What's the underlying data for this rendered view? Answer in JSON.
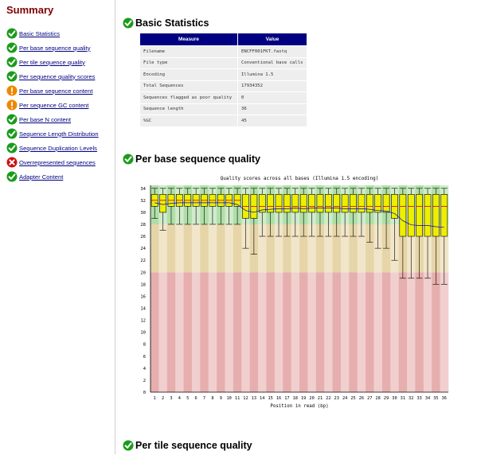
{
  "summary": {
    "title": "Summary",
    "items": [
      {
        "label": "Basic Statistics",
        "status": "pass"
      },
      {
        "label": "Per base sequence quality",
        "status": "pass"
      },
      {
        "label": "Per tile sequence quality",
        "status": "pass"
      },
      {
        "label": "Per sequence quality scores",
        "status": "pass"
      },
      {
        "label": "Per base sequence content",
        "status": "warn"
      },
      {
        "label": "Per sequence GC content",
        "status": "warn"
      },
      {
        "label": "Per base N content",
        "status": "pass"
      },
      {
        "label": "Sequence Length Distribution",
        "status": "pass"
      },
      {
        "label": "Sequence Duplication Levels",
        "status": "pass"
      },
      {
        "label": "Overrepresented sequences",
        "status": "fail"
      },
      {
        "label": "Adapter Content",
        "status": "pass"
      }
    ]
  },
  "basic_stats": {
    "title": "Basic Statistics",
    "status": "pass",
    "headers": [
      "Measure",
      "Value"
    ],
    "rows": [
      [
        "Filename",
        "ENCFF001FKT.fastq"
      ],
      [
        "File type",
        "Conventional base calls"
      ],
      [
        "Encoding",
        "Illumina 1.5"
      ],
      [
        "Total Sequences",
        "17934352"
      ],
      [
        "Sequences flagged as poor quality",
        "0"
      ],
      [
        "Sequence length",
        "36"
      ],
      [
        "%GC",
        "45"
      ]
    ]
  },
  "per_base_quality": {
    "title": "Per base sequence quality",
    "status": "pass"
  },
  "per_tile_quality": {
    "title": "Per tile sequence quality",
    "status": "pass"
  },
  "colors": {
    "pass": "#1a9c1a",
    "warn": "#ee8800",
    "fail": "#cc1111",
    "link": "#000080",
    "summary_title": "#800000",
    "table_header": "#000080",
    "box_fill": "#eeee00",
    "median": "#cc0000",
    "mean_line": "#0000cc"
  },
  "chart_data": {
    "type": "box",
    "title": "Quality scores across all bases (Illumina 1.5 encoding)",
    "xlabel": "Position in read (bp)",
    "ylabel": "",
    "ylim": [
      0,
      34
    ],
    "yticks": [
      0,
      2,
      4,
      6,
      8,
      10,
      12,
      14,
      16,
      18,
      20,
      22,
      24,
      26,
      28,
      30,
      32,
      34
    ],
    "categories": [
      "1",
      "2",
      "3",
      "4",
      "5",
      "6",
      "7",
      "8",
      "9",
      "10",
      "11",
      "12",
      "13",
      "14",
      "15",
      "16",
      "17",
      "18",
      "19",
      "20",
      "21",
      "22",
      "23",
      "24",
      "25",
      "26",
      "27",
      "28",
      "29",
      "30",
      "31",
      "32",
      "33",
      "34",
      "35",
      "36"
    ],
    "zones": [
      {
        "from": 0,
        "to": 20,
        "color": "#e6aeae",
        "color_alt": "#f1cfcf"
      },
      {
        "from": 20,
        "to": 28,
        "color": "#e6d5a8",
        "color_alt": "#f1e6ca"
      },
      {
        "from": 28,
        "to": 34.5,
        "color": "#b0dea8",
        "color_alt": "#d0ebca"
      }
    ],
    "series": {
      "upper_whisker": [
        34,
        34,
        34,
        34,
        34,
        34,
        34,
        34,
        34,
        34,
        34,
        34,
        34,
        34,
        34,
        34,
        34,
        34,
        34,
        34,
        34,
        34,
        34,
        34,
        34,
        34,
        34,
        34,
        34,
        34,
        34,
        34,
        34,
        34,
        34,
        34
      ],
      "q3": [
        33,
        33,
        33,
        33,
        33,
        33,
        33,
        33,
        33,
        33,
        33,
        33,
        33,
        33,
        33,
        33,
        33,
        33,
        33,
        33,
        33,
        33,
        33,
        33,
        33,
        33,
        33,
        33,
        33,
        33,
        33,
        33,
        33,
        33,
        33,
        33
      ],
      "median": [
        32,
        32,
        32,
        32,
        32,
        32,
        32,
        32,
        32,
        32,
        32,
        31,
        31,
        31,
        31,
        31,
        31,
        31,
        31,
        31,
        31,
        31,
        31,
        31,
        31,
        31,
        31,
        31,
        31,
        31,
        31,
        31,
        31,
        31,
        31,
        31
      ],
      "q1": [
        31,
        30,
        31,
        31,
        31,
        31,
        31,
        31,
        31,
        31,
        31,
        29,
        29,
        30,
        30,
        30,
        30,
        30,
        30,
        30,
        30,
        30,
        30,
        30,
        30,
        30,
        30,
        30,
        30,
        29,
        26,
        26,
        26,
        26,
        26,
        26
      ],
      "lower_whisker": [
        29,
        27,
        28,
        28,
        28,
        28,
        28,
        28,
        28,
        28,
        28,
        24,
        23,
        26,
        26,
        26,
        26,
        26,
        26,
        26,
        26,
        26,
        26,
        26,
        26,
        26,
        25,
        24,
        24,
        22,
        19,
        19,
        19,
        19,
        18,
        18
      ],
      "mean": [
        31.6,
        31.3,
        31.5,
        31.6,
        31.6,
        31.6,
        31.6,
        31.6,
        31.6,
        31.6,
        31.3,
        30.3,
        30.0,
        30.4,
        30.5,
        30.6,
        30.6,
        30.7,
        30.6,
        30.7,
        30.7,
        30.7,
        30.7,
        30.6,
        30.6,
        30.6,
        30.5,
        30.3,
        30.2,
        29.8,
        28.6,
        27.9,
        27.8,
        27.8,
        27.6,
        27.5
      ]
    }
  }
}
